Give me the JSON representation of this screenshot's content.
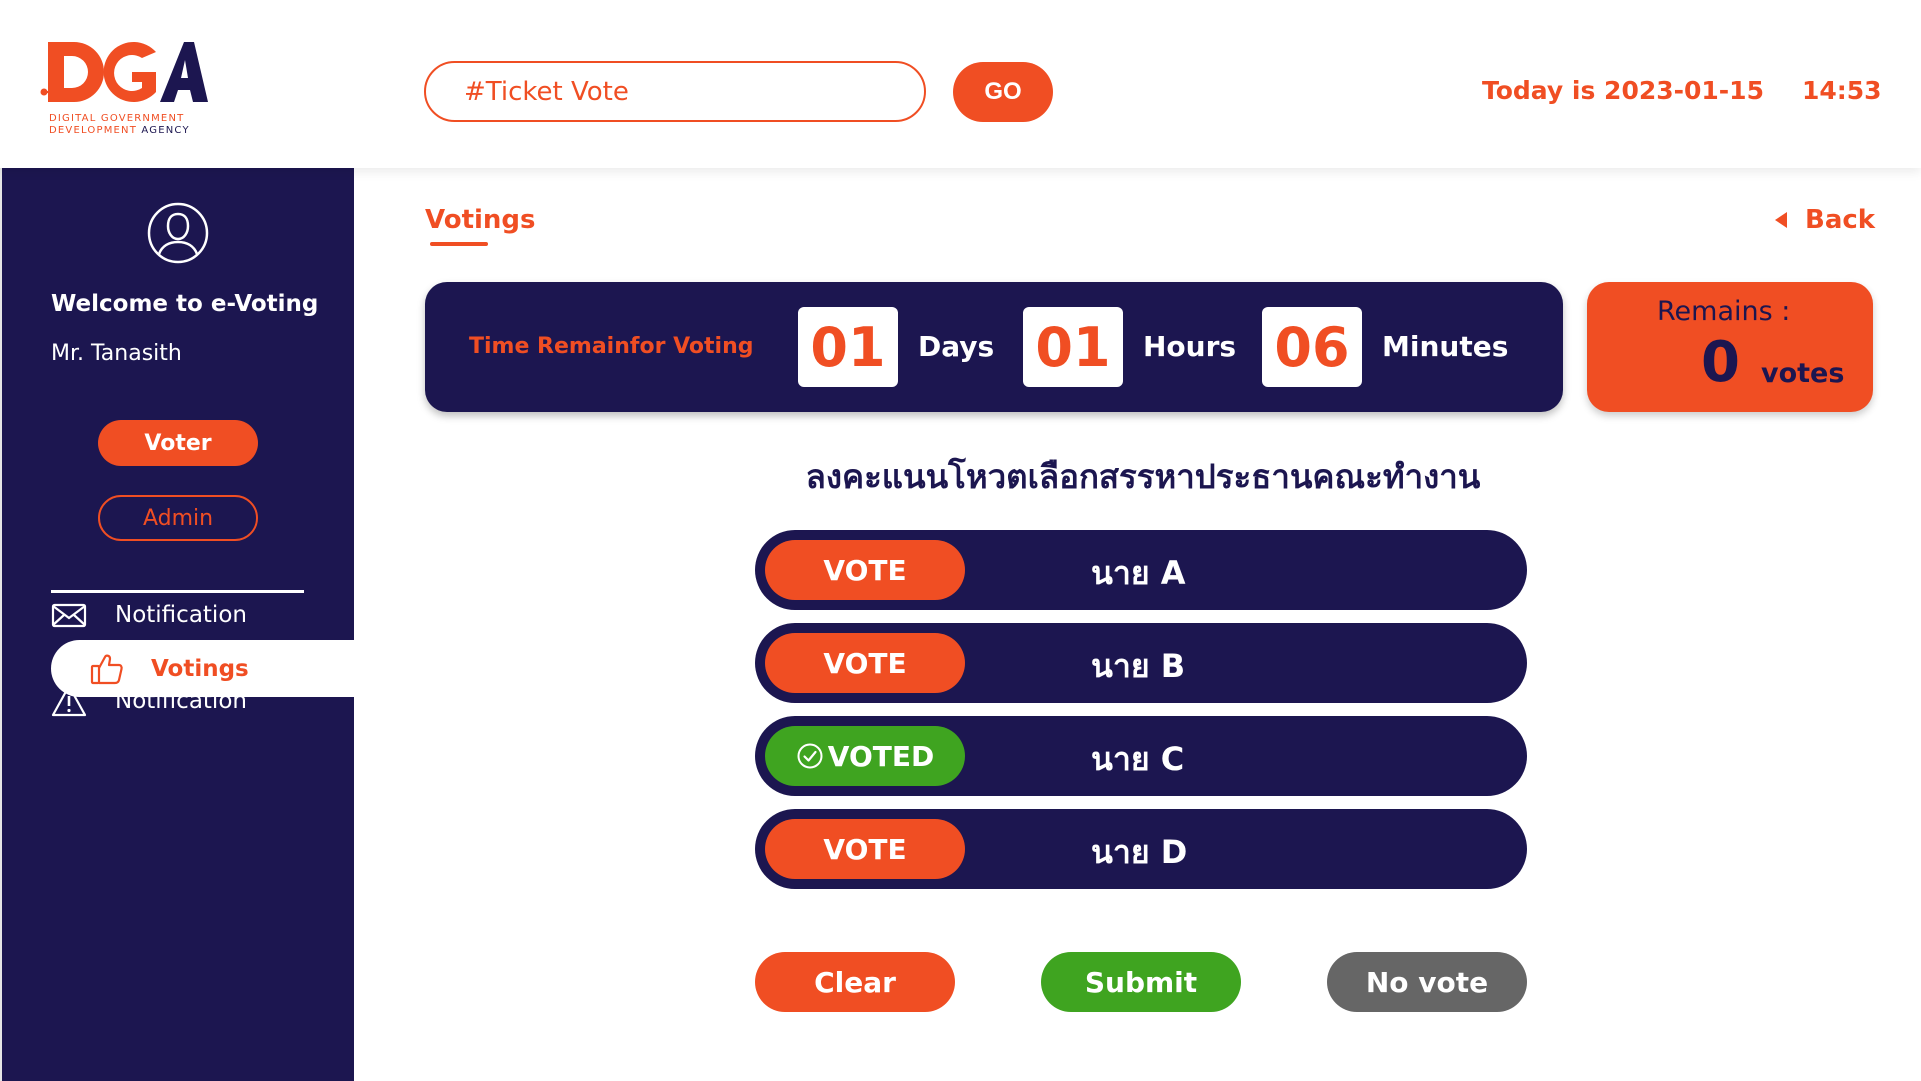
{
  "brand": {
    "logo_text": "DGA",
    "logo_sub_line1": "DIGITAL GOVERNMENT",
    "logo_sub_line2_a": "DEVELOPMENT",
    "logo_sub_line2_b": "AGENCY"
  },
  "header": {
    "search_placeholder": "#Ticket Vote",
    "go_label": "GO",
    "today": "Today is 2023-01-15",
    "time": "14:53"
  },
  "sidebar": {
    "welcome": "Welcome to e-Voting",
    "username": "Mr. Tanasith",
    "roles": {
      "voter": "Voter",
      "admin": "Admin"
    },
    "nav": [
      {
        "label": "Votings",
        "icon": "thumbs-up-icon",
        "active": true
      },
      {
        "label": "Notification",
        "icon": "mail-icon",
        "active": false
      },
      {
        "label": "Notification",
        "icon": "warning-icon",
        "active": false
      }
    ]
  },
  "main": {
    "tab_title": "Votings",
    "back_label": "Back",
    "timer": {
      "label": "Time Remainfor Voting",
      "days": "01",
      "days_unit": "Days",
      "hours": "01",
      "hours_unit": "Hours",
      "minutes": "06",
      "minutes_unit": "Minutes"
    },
    "remains": {
      "label": "Remains :",
      "count": "0",
      "unit": "votes"
    },
    "question": "ลงคะแนนโหวตเลือกสรรหาประธานคณะทำงาน",
    "candidates": [
      {
        "button": "VOTE",
        "name": "นาย A",
        "voted": false
      },
      {
        "button": "VOTE",
        "name": "นาย B",
        "voted": false
      },
      {
        "button": "VOTED",
        "name": "นาย C",
        "voted": true
      },
      {
        "button": "VOTE",
        "name": "นาย D",
        "voted": false
      }
    ],
    "actions": {
      "clear": "Clear",
      "submit": "Submit",
      "no_vote": "No vote"
    }
  },
  "colors": {
    "accent": "#f04e23",
    "navy": "#1c1650",
    "success": "#3fa420",
    "neutral": "#666666"
  }
}
